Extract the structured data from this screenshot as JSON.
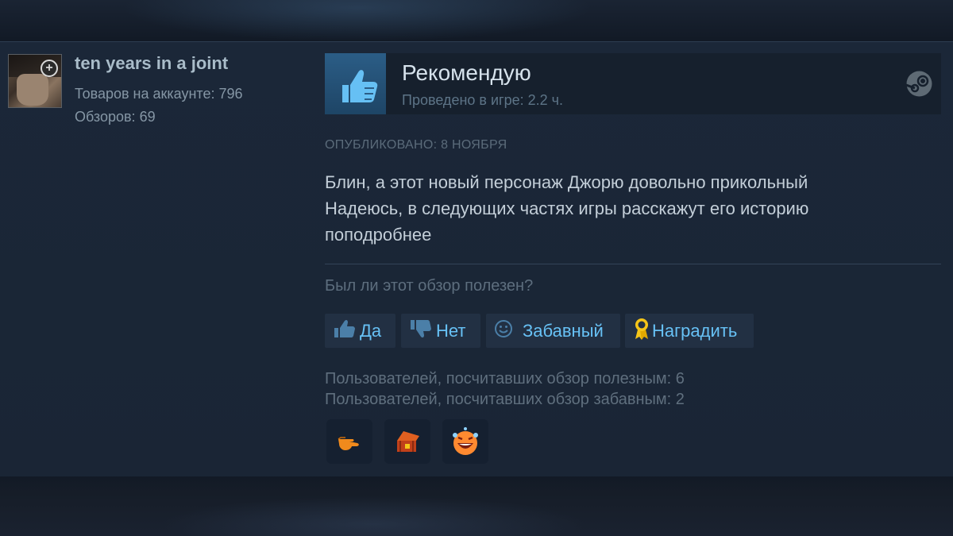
{
  "user": {
    "name": "ten years in a joint",
    "products": "Товаров на аккаунте: 796",
    "reviews": "Обзоров: 69"
  },
  "review": {
    "verdict": "Рекомендую",
    "hours": "Проведено в игре: 2.2 ч.",
    "posted": "ОПУБЛИКОВАНО: 8 НОЯБРЯ",
    "text_line1": "Блин, а этот новый персонаж Джорю довольно прикольный",
    "text_line2": "Надеюсь, в следующих частях игры расскажут его историю",
    "text_line3": "поподробнее"
  },
  "feedback": {
    "question": "Был ли этот обзор полезен?",
    "yes_label": "Да",
    "no_label": "Нет",
    "funny_label": "Забавный",
    "award_label": "Наградить",
    "helpful_count": "Пользователей, посчитавших обзор полезным: 6",
    "funny_count": "Пользователей, посчитавших обзор забавным: 2"
  },
  "icons": {
    "verdict": "thumbs-up-icon",
    "platform": "steam-icon",
    "yes": "thumbs-up-icon",
    "no": "thumbs-down-icon",
    "funny": "smiley-icon",
    "award": "ribbon-icon",
    "awards": [
      "pointing-hand-icon",
      "treasure-chest-icon",
      "laughing-face-icon"
    ]
  },
  "colors": {
    "accent": "#67c1f5",
    "panel": "#1b2738",
    "button": "#223043",
    "thumb_box": "#2b5d86"
  }
}
